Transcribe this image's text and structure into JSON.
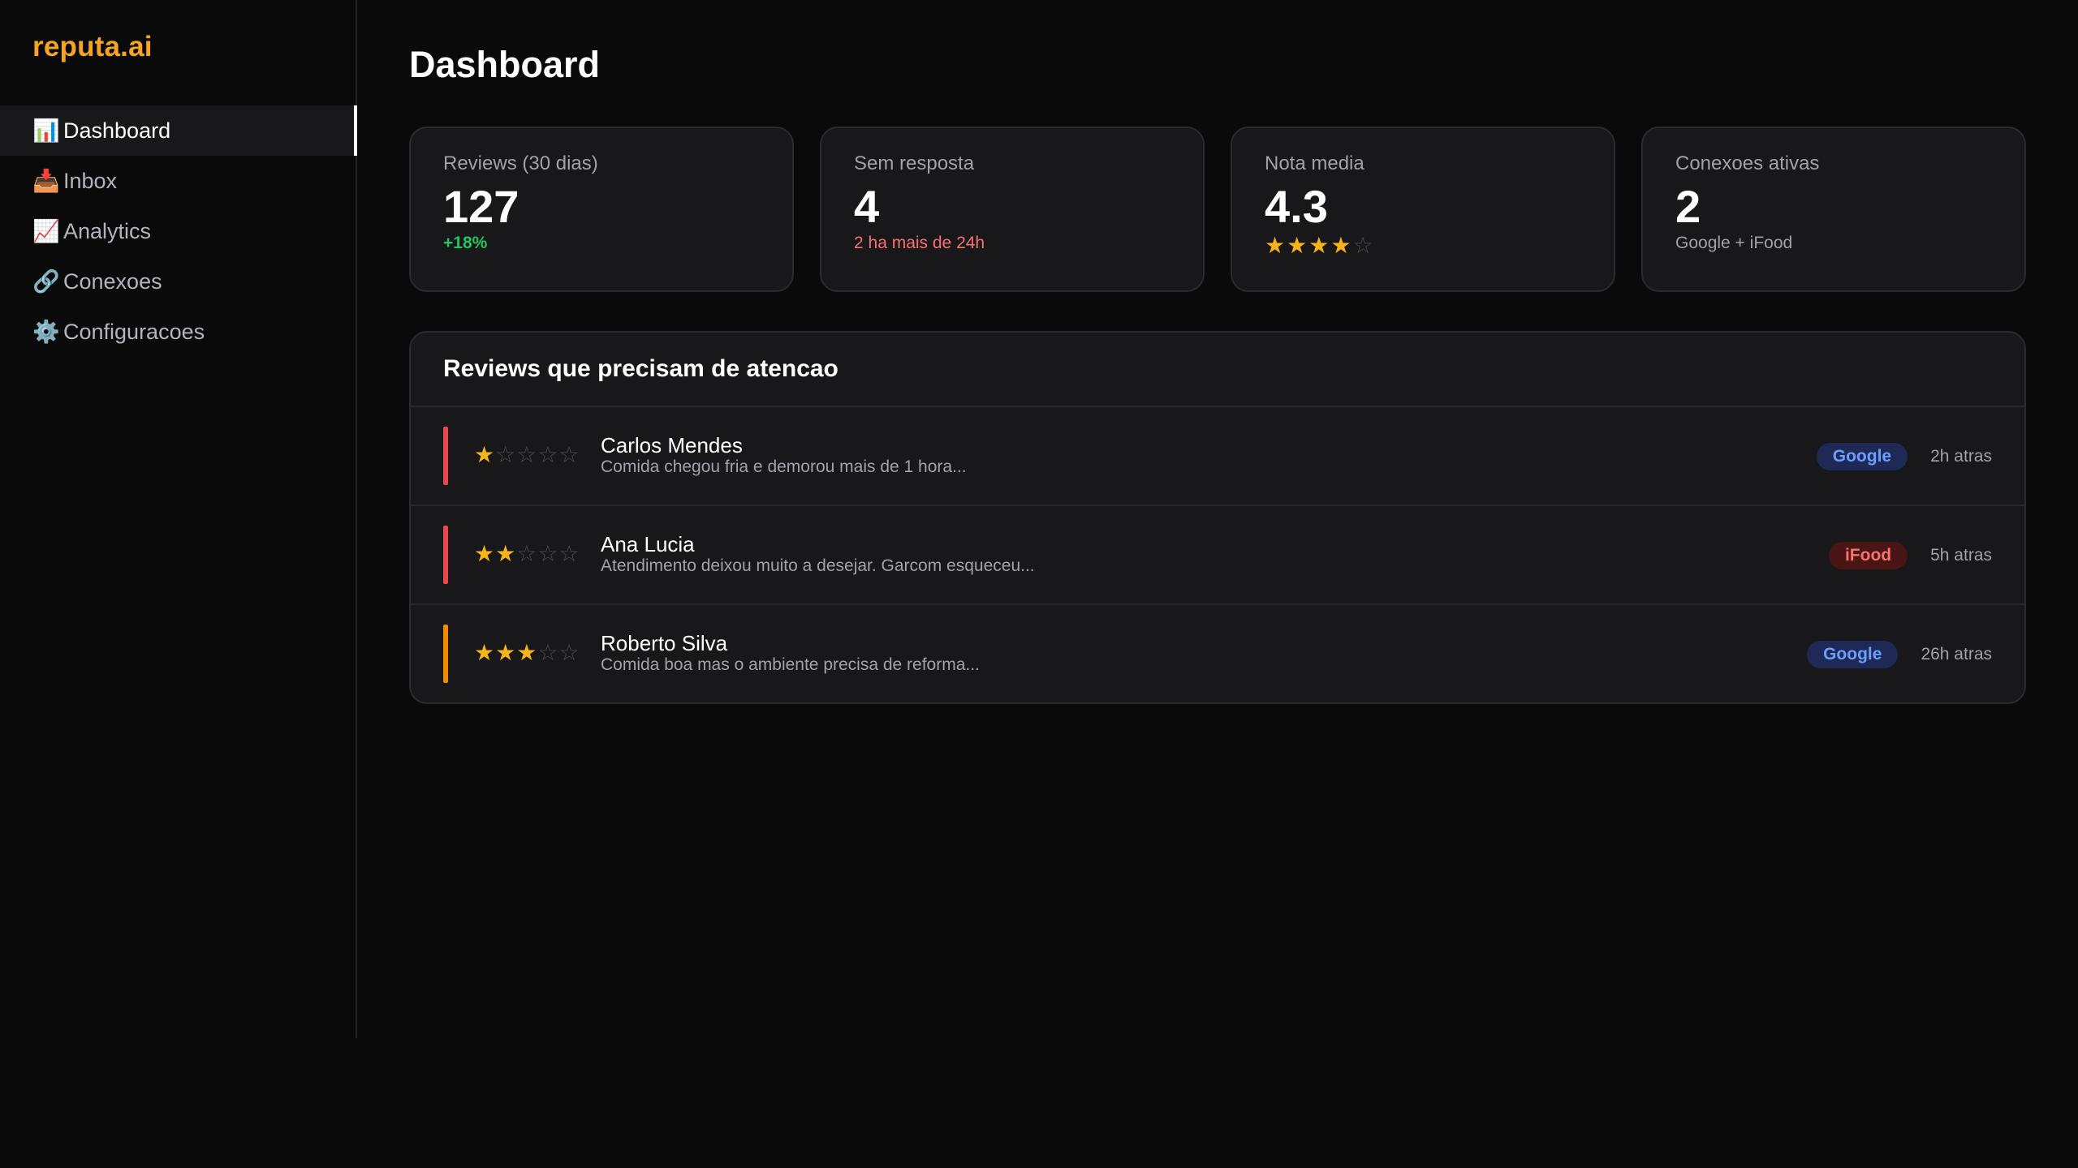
{
  "app": {
    "logo": "reputa.ai"
  },
  "sidebar": {
    "items": [
      {
        "icon": "📊",
        "icon_name": "bar-chart-icon",
        "label": "Dashboard",
        "active": true
      },
      {
        "icon": "📥",
        "icon_name": "inbox-tray-icon",
        "label": "Inbox"
      },
      {
        "icon": "📈",
        "icon_name": "trending-chart-icon",
        "label": "Analytics"
      },
      {
        "icon": "🔗",
        "icon_name": "link-icon",
        "label": "Conexoes"
      },
      {
        "icon": "⚙️",
        "icon_name": "gear-icon",
        "label": "Configuracoes"
      }
    ]
  },
  "page": {
    "title": "Dashboard"
  },
  "stats": [
    {
      "label": "Reviews (30 dias)",
      "value": "127",
      "sub": "+18%"
    },
    {
      "label": "Sem resposta",
      "value": "4",
      "sub": "2 ha mais de 24h"
    },
    {
      "label": "Nota media",
      "value": "4.3",
      "rating": 4,
      "max": 5
    },
    {
      "label": "Conexoes ativas",
      "value": "2",
      "sub": "Google + iFood"
    }
  ],
  "attention": {
    "title": "Reviews que precisam de atencao",
    "reviews": [
      {
        "rating": 1,
        "name": "Carlos Mendes",
        "excerpt": "Comida chegou fria e demorou mais de 1 hora...",
        "source": "Google",
        "time": "2h atras",
        "bar_color": "#e5484d"
      },
      {
        "rating": 2,
        "name": "Ana Lucia",
        "excerpt": "Atendimento deixou muito a desejar. Garcom esqueceu...",
        "source": "iFood",
        "time": "5h atras",
        "bar_color": "#e5484d"
      },
      {
        "rating": 3,
        "name": "Roberto Silva",
        "excerpt": "Comida boa mas o ambiente precisa de reforma...",
        "source": "Google",
        "time": "26h atras",
        "bar_color": "#f08c00"
      }
    ]
  },
  "colors": {
    "accent": "#f5a524",
    "star": "#f5b41a",
    "positive": "#22c55e",
    "negative": "#f87171"
  }
}
